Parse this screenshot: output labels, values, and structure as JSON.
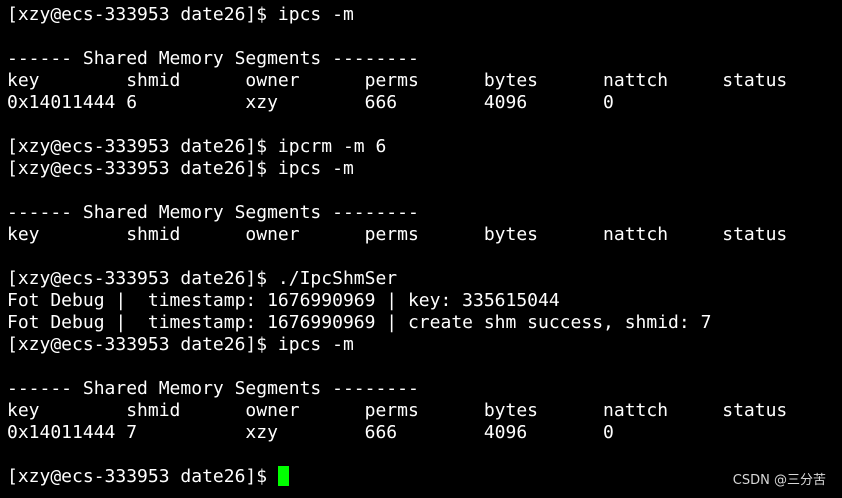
{
  "terminal": {
    "cursor_color": "#00ff00",
    "text_color": "#ffffff",
    "background": "#000000",
    "lines": [
      "[xzy@ecs-333953 date26]$ ipcs -m",
      "",
      "------ Shared Memory Segments --------",
      "key        shmid      owner      perms      bytes      nattch     status",
      "0x14011444 6          xzy        666        4096       0",
      "",
      "[xzy@ecs-333953 date26]$ ipcrm -m 6",
      "[xzy@ecs-333953 date26]$ ipcs -m",
      "",
      "------ Shared Memory Segments --------",
      "key        shmid      owner      perms      bytes      nattch     status",
      "",
      "[xzy@ecs-333953 date26]$ ./IpcShmSer",
      "Fot Debug |  timestamp: 1676990969 | key: 335615044",
      "Fot Debug |  timestamp: 1676990969 | create shm success, shmid: 7",
      "[xzy@ecs-333953 date26]$ ipcs -m",
      "",
      "------ Shared Memory Segments --------",
      "key        shmid      owner      perms      bytes      nattch     status",
      "0x14011444 7          xzy        666        4096       0",
      ""
    ],
    "prompt": "[xzy@ecs-333953 date26]$ "
  },
  "watermark": "CSDN @三分苦"
}
